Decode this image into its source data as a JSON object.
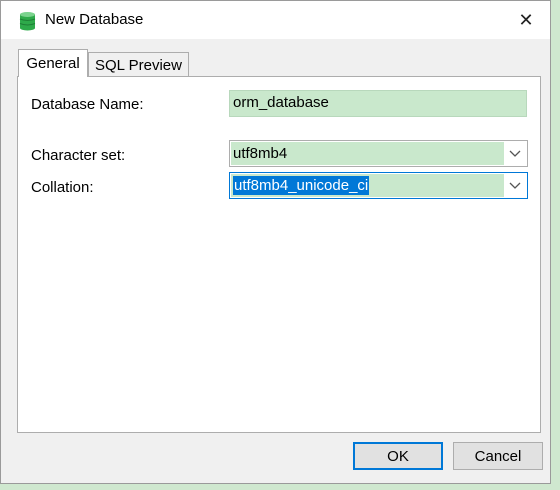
{
  "window": {
    "title": "New Database",
    "close_symbol": "✕"
  },
  "tabs": [
    {
      "label": "General",
      "active": true
    },
    {
      "label": "SQL Preview",
      "active": false
    }
  ],
  "form": {
    "database_name": {
      "label": "Database Name:",
      "value": "orm_database"
    },
    "character_set": {
      "label": "Character set:",
      "value": "utf8mb4"
    },
    "collation": {
      "label": "Collation:",
      "value": "utf8mb4_unicode_ci"
    }
  },
  "buttons": {
    "ok": "OK",
    "cancel": "Cancel"
  },
  "colors": {
    "field_highlight": "#c9e8cc",
    "accent": "#0078d7",
    "icon": "#2eaa4a"
  }
}
